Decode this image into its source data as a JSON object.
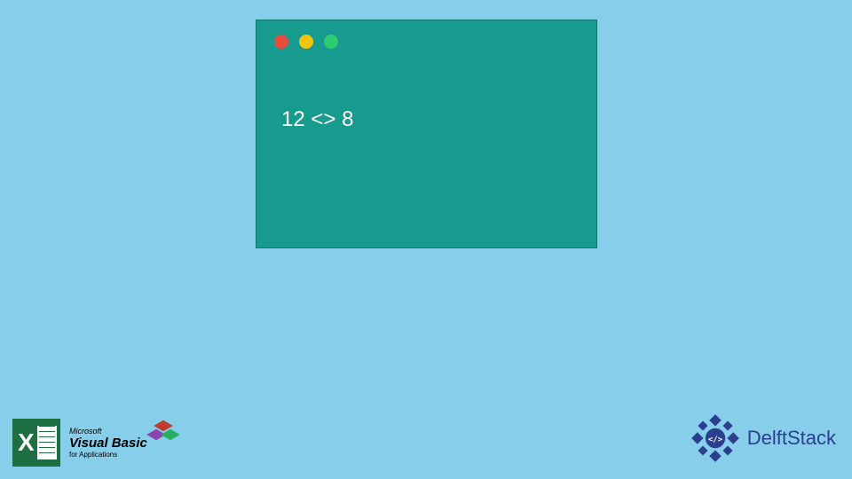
{
  "code_window": {
    "content": "12 <> 8",
    "traffic_lights": {
      "red": "#e74c3c",
      "yellow": "#f1c40f",
      "green": "#2ecc71"
    }
  },
  "logos": {
    "vb": {
      "ms": "Microsoft",
      "title": "Visual Basic",
      "sub": "for Applications"
    },
    "delft": {
      "text": "DelftStack"
    }
  }
}
